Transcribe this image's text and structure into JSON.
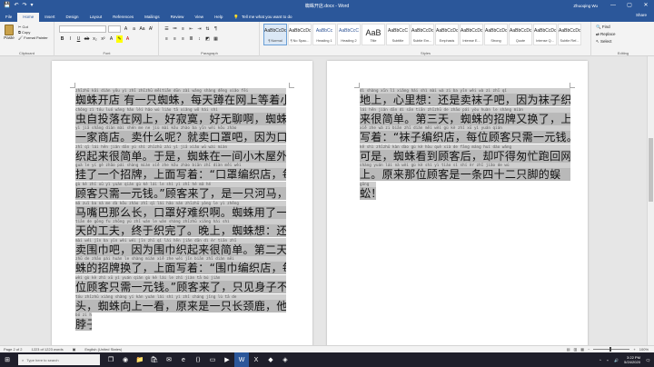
{
  "window": {
    "title": "蜘蛛开店.docx - Word",
    "user": "Zhuoqing Wu",
    "controls": [
      "—",
      "▢",
      "✕"
    ]
  },
  "tabs": [
    "File",
    "Home",
    "Insert",
    "Design",
    "Layout",
    "References",
    "Mailings",
    "Review",
    "View",
    "Help"
  ],
  "active_tab": "Home",
  "tellme": "Tell me what you want to do",
  "share": "Share",
  "ribbon": {
    "clipboard": {
      "paste": "Paste",
      "cut": "Cut",
      "copy": "Copy",
      "format_painter": "Format Painter",
      "label": "Clipboard"
    },
    "font": {
      "name": "",
      "size": "",
      "label": "Font"
    },
    "paragraph": {
      "label": "Paragraph"
    },
    "styles": {
      "label": "Styles",
      "items": [
        {
          "preview": "AaBbCcDc",
          "name": "¶ Normal"
        },
        {
          "preview": "AaBbCcDc",
          "name": "¶ No Spac..."
        },
        {
          "preview": "AaBbCc",
          "name": "Heading 1"
        },
        {
          "preview": "AaBbCcC",
          "name": "Heading 2"
        },
        {
          "preview": "AaB",
          "name": "Title"
        },
        {
          "preview": "AaBbCcC",
          "name": "Subtitle"
        },
        {
          "preview": "AaBbCcDc",
          "name": "Subtle Em..."
        },
        {
          "preview": "AaBbCcDc",
          "name": "Emphasis"
        },
        {
          "preview": "AaBbCcDc",
          "name": "Intense E..."
        },
        {
          "preview": "AaBbCcDc",
          "name": "Strong"
        },
        {
          "preview": "AaBbCcDc",
          "name": "Quote"
        },
        {
          "preview": "AaBbCcDc",
          "name": "Intense Q..."
        },
        {
          "preview": "AaBbCcDc",
          "name": "Subtle Ref..."
        }
      ]
    },
    "editing": {
      "find": "Find",
      "replace": "Replace",
      "select": "Select",
      "label": "Editing"
    }
  },
  "page1": [
    {
      "py": "zhīzhū kāi diàn  yǒu yì zhī zhīzhū měitiān dūn zài wǎng shàng děng xiǎo fēi",
      "hz": "蜘蛛开店 有一只蜘蛛，每天蹲在网上等着小飞"
    },
    {
      "py": "chóng zì tóu luó wǎng  hǎo lèi  hǎo wú liáo  tā xiǎng  wǒ hái shì",
      "hz": "虫自投落在网上，好寂寞，好无聊啊，蜘蛛决定开"
    },
    {
      "py": "yì jiā shāng diàn  mài shén me ne  jiù mài kǒu zhào ba  yīn wèi kǒu zhào",
      "hz": "一家商店。卖什么呢？就卖口罩吧，因为口罩"
    },
    {
      "py": "zhī qǐ lái hěn jiǎn dān  yú shì  zhīzhū zài yì jiā xiǎo wū wài miàn",
      "hz": "织起来很简单。于是，蜘蛛在一间小木屋外面"
    },
    {
      "py": "guà le yí gè zhāo pái  shàng miàn xiě zhe  kǒu zhào biān zhī diàn  měi wèi",
      "hz": "挂了一个招牌，上面写着：“口罩编织店，每位"
    },
    {
      "py": "gù kè zhǐ xū yì yuán qián  gù kè lái le  shì  yì zhī hé mǎ  hé",
      "hz": "顾客只需一元钱。”顾客来了，是一只河马，河"
    },
    {
      "py": "mǎ zuǐ ba nà me dà  kǒu zhào zhī qǐ lái hǎo nán  zhīzhū yòng le yì zhěng",
      "hz": "马嘴巴那么长，口罩好难织啊。蜘蛛用了一整"
    },
    {
      "py": "tiān de gōng fu  zhōng yú zhī wán le  wǎn shàng  zhīzhū xiǎng  hái shì",
      "hz": "天的工夫，终于织完了。晚上，蜘蛛想：还是"
    },
    {
      "py": "mài wéi jīn ba  yīn wèi wéi jīn zhī qǐ lái hěn jiǎn dān  dì èr tiān  zhī",
      "hz": "卖围巾吧，因为围巾织起来很简单。第二天，蜘"
    },
    {
      "py": "zhū de zhāo pái huàn le  shàng miàn xiě zhe  wéi jīn biān zhī diàn  měi",
      "hz": "蛛的招牌换了，上面写着：“围巾编织店，每"
    },
    {
      "py": "wèi gù kè zhǐ xū yì yuán qián  gù kè lái le  zhǐ jiàn tā bú jiàn",
      "hz": "位顾客只需一元钱。”顾客来了，只见身子不见"
    },
    {
      "py": "tóu  zhīzhū xiàng shàng yí kàn  yuán lái shì yì zhī cháng jǐng lù  tā de",
      "hz": "头，蜘蛛向上一看，原来是一只长颈鹿，他的"
    },
    {
      "py": "bó zi hé dà shù yí yàng gāo  nǎo dai cóng shù yè lǐ lù chū lái  zhèng",
      "hz": "脖子和大树一样高，脑袋从树叶里露出来，正"
    }
  ],
  "page2": [
    {
      "py": "dì shàng  xīn lǐ xiǎng  hái shì mài wà zi ba  yīn wèi wà zi zhī qǐ",
      "hz": "地上，心里想：还是卖袜子吧，因为袜子织起"
    },
    {
      "py": "lái hěn jiǎn dān  dì sān tiān  zhīzhū de zhāo pái yòu huàn le  shàng miàn",
      "hz": "来很简单。第三天，蜘蛛的招牌又换了，上面"
    },
    {
      "py": "xiě zhe  wà zi biān zhī diàn  měi wèi gù kè zhǐ xū yì yuán qián",
      "hz": "写着：“袜子编织店，每位顾客只需一元钱。”"
    },
    {
      "py": "kě shì  zhīzhū kàn dào gù kè hòu  què xià de fāng máng huí dào wǎng",
      "hz": "可是，蜘蛛看到顾客后，却吓得匆忙跑回网"
    },
    {
      "py": "shàng  yuán lái nà wèi gù kè shì yì tiáo sì shí èr zhī jiǎo de wú",
      "hz": "上。原来那位顾客是一条四十二只脚的蜈"
    },
    {
      "py": "gōng",
      "hz": "蚣！"
    }
  ],
  "status": {
    "page": "Page 2 of 2",
    "words": "1223 of 1223 words",
    "language": "English (United States)",
    "zoom": "100%"
  },
  "taskbar": {
    "search": "Type here to search",
    "time": "3:22 PM",
    "date": "5/24/2020"
  }
}
